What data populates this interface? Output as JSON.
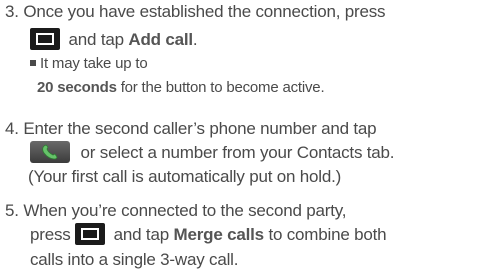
{
  "steps": [
    {
      "number": "3.",
      "text_a": "Once you have established the connection, press",
      "text_b_after_icon": "and tap",
      "bold": "Add call",
      "text_c": ".",
      "icon": "menu-icon"
    },
    {
      "number": "4.",
      "text_a": "Enter the second caller’s phone number and tap",
      "text_b_after_icon": "or select a number from your Contacts tab.",
      "text_c": "(Your first call is automatically put on hold.)",
      "icon": "call-icon"
    },
    {
      "number": "5.",
      "text_a": "When you’re connected to the second party,",
      "text_b_before_icon": "press",
      "text_b_after_icon": "and tap",
      "bold": "Merge calls",
      "text_b_end": "to combine both",
      "text_c": "calls into a single 3-way call.",
      "icon": "menu-icon"
    }
  ],
  "note": {
    "line1": "It may take up to",
    "bold": "20 seconds",
    "line2_rest": "for the button to become active."
  },
  "colors": {
    "text": "#4a4a4a",
    "call_icon_green": "#4caf50"
  }
}
